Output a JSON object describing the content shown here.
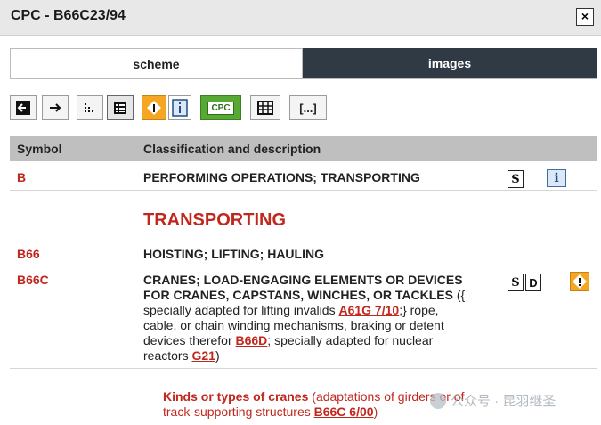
{
  "window": {
    "title": "CPC - B66C23/94",
    "close_label": "×"
  },
  "tabs": [
    {
      "label": "scheme",
      "active": true
    },
    {
      "label": "images",
      "active": false
    }
  ],
  "toolbar": {
    "buttons": [
      {
        "name": "nav-back-icon"
      },
      {
        "name": "nav-forward-icon"
      },
      {
        "name": "tree-view-icon"
      },
      {
        "name": "list-view-icon"
      },
      {
        "name": "warning-icon"
      },
      {
        "name": "info-icon"
      },
      {
        "name": "cpc-icon",
        "label": "CPC"
      },
      {
        "name": "table-icon"
      },
      {
        "name": "ellipsis-icon",
        "label": "[...]"
      }
    ]
  },
  "table": {
    "headers": {
      "symbol": "Symbol",
      "description": "Classification and description"
    },
    "rows": [
      {
        "symbol": "B",
        "title": "PERFORMING OPERATIONS; TRANSPORTING"
      },
      {
        "section_heading": "TRANSPORTING"
      },
      {
        "symbol": "B66",
        "title": "HOISTING; LIFTING; HAULING"
      },
      {
        "symbol": "B66C",
        "title_line1": "CRANES; LOAD-ENGAGING ELEMENTS OR DEVICES",
        "title_line2": "FOR CRANES, CAPSTANS, WINCHES, OR TACKLES",
        "note_open": "({",
        "line3_pre": "specially adapted for lifting invalids",
        "ref1": "A61G 7/10",
        "line3_post": ";} rope,",
        "line4": "cable, or chain winding mechanisms, braking or detent",
        "line5_pre": "devices therefor",
        "ref2": "B66D",
        "line5_post": "; specially adapted for nuclear",
        "line6_pre": "reactors",
        "ref3": "G21",
        "line6_post": ")"
      },
      {
        "kinds_title": "Kinds or types of cranes",
        "kinds_line1": "(adaptations of girders or of",
        "kinds_line2": "track-supporting structures",
        "kinds_ref": "B66C 6/00",
        "kinds_close": ")"
      }
    ],
    "icons": {
      "s": "S",
      "d": "D",
      "i": "i"
    }
  },
  "watermark": {
    "text": "公众号 · 昆羽继圣"
  },
  "colors": {
    "accent_red": "#c0281e",
    "tab_dark": "#2f3a44",
    "header_gray": "#bfbfbf",
    "warn_orange": "#f5a623",
    "cpc_green": "#58a834"
  }
}
